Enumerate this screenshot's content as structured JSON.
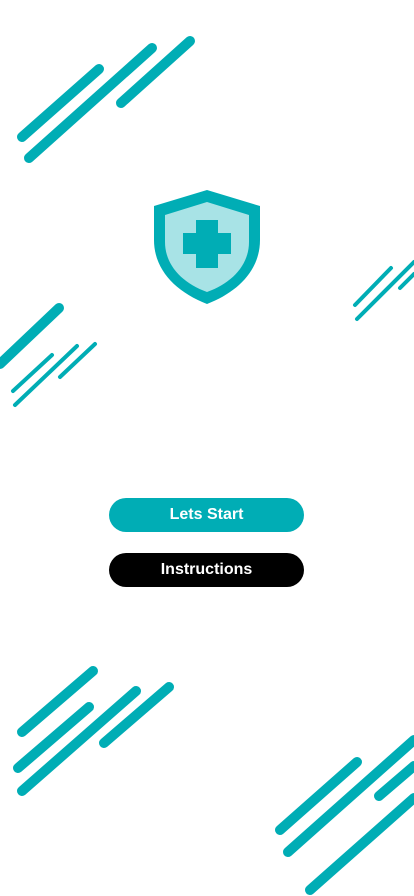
{
  "buttons": {
    "start_label": "Lets Start",
    "instructions_label": "Instructions"
  },
  "logo": {
    "icon": "shield-plus-icon"
  },
  "colors": {
    "accent": "#00adb5",
    "accent_light": "#a8e3e6",
    "dark_button": "#000000",
    "background": "#ffffff"
  }
}
